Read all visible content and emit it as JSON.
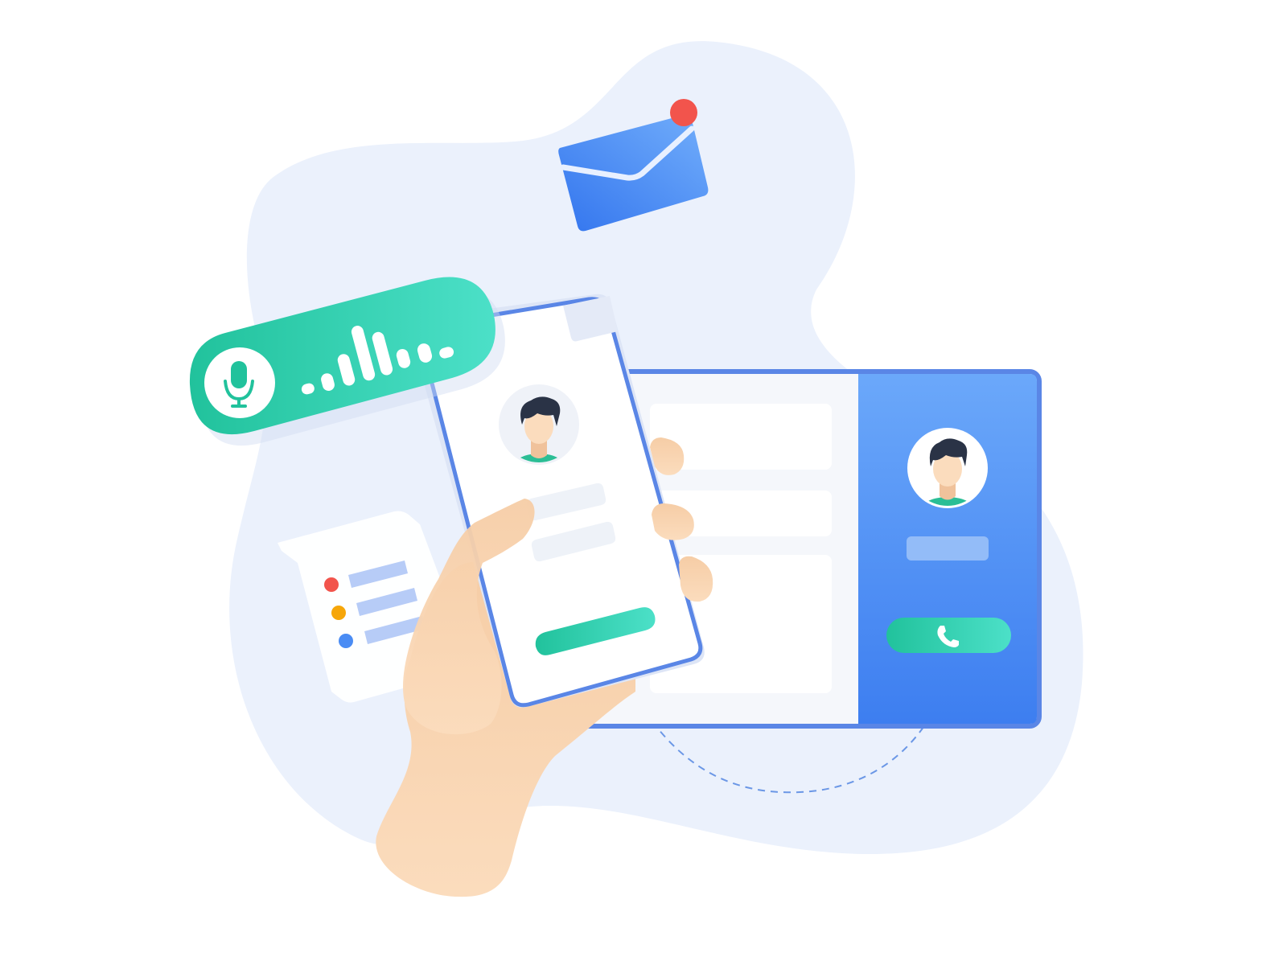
{
  "illustration": {
    "elements": [
      "background-blob",
      "envelope-icon",
      "notification-dot",
      "voice-message-bubble",
      "microphone-icon",
      "sound-wave-icon",
      "chat-bubble",
      "desktop-window",
      "phone-icon",
      "smartphone",
      "avatar",
      "hand"
    ]
  },
  "colors": {
    "background_blob": "#EBF1FC",
    "window_border": "#5A86E6",
    "window_panel_top": "#6BA8FA",
    "window_panel_bottom": "#3D7EF0",
    "voice_bubble_start": "#21C29C",
    "voice_bubble_end": "#4CE0C8",
    "envelope": "#4A8CF4",
    "notification": "#F2544C",
    "skin": "#F9D7B6",
    "hair": "#2A3346",
    "shirt": "#2BBE95",
    "placeholder": "#EEF2F8",
    "chat_dot_red": "#F2544C",
    "chat_dot_orange": "#F6A609",
    "chat_dot_blue": "#4A8CF4",
    "chat_line": "#B7CCF7"
  }
}
